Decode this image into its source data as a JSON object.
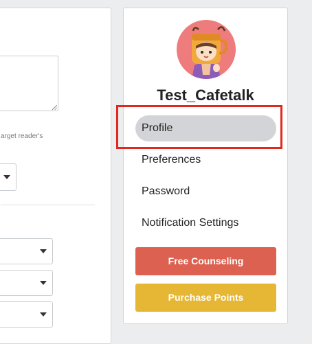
{
  "form": {
    "hint_text": "arget reader's"
  },
  "profile": {
    "username": "Test_Cafetalk",
    "avatar_icon": "cafetalk-mascot-avatar-icon"
  },
  "nav": {
    "items": [
      {
        "label": "Profile",
        "active": true
      },
      {
        "label": "Preferences",
        "active": false
      },
      {
        "label": "Password",
        "active": false
      },
      {
        "label": "Notification Settings",
        "active": false
      }
    ]
  },
  "buttons": {
    "free_counseling": "Free Counseling",
    "purchase_points": "Purchase Points"
  },
  "colors": {
    "counseling_button": "#dd6150",
    "points_button": "#e6b734",
    "active_nav": "#d2d4d7",
    "highlight_border": "#e2271c",
    "avatar_bg": "#ef7c7c"
  }
}
